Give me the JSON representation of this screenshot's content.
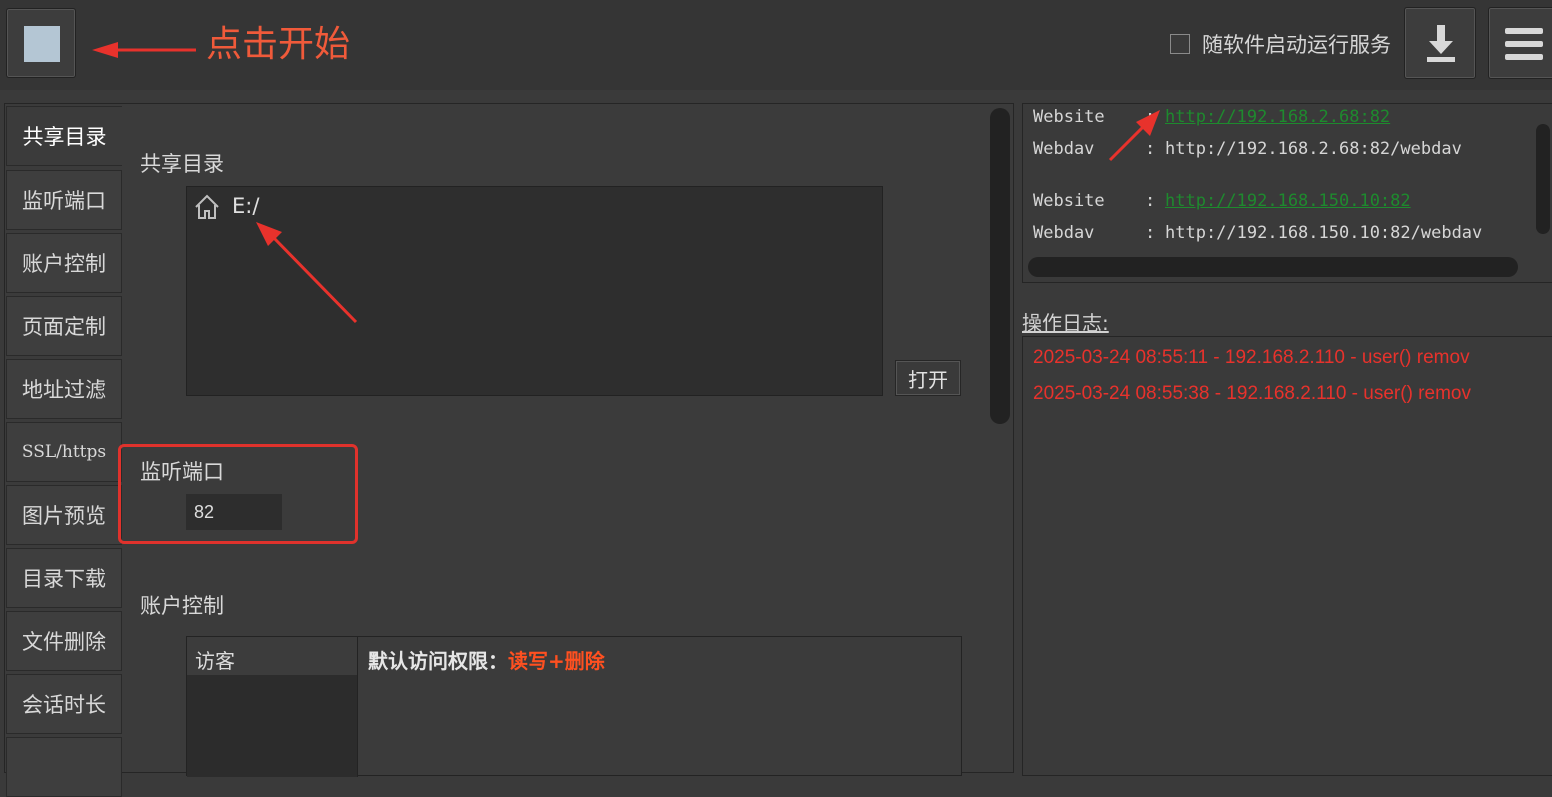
{
  "toolbar": {
    "start_icon": "stop-square-icon",
    "autostart_label": "随软件启动运行服务",
    "download_icon": "download-icon",
    "menu_icon": "hamburger-menu-icon"
  },
  "annotations": {
    "start_hint": "点击开始",
    "color": "#f05a3a"
  },
  "sidebar": {
    "items": [
      {
        "label": "共享目录"
      },
      {
        "label": "监听端口"
      },
      {
        "label": "账户控制"
      },
      {
        "label": "页面定制"
      },
      {
        "label": "地址过滤"
      },
      {
        "label": "SSL/https"
      },
      {
        "label": "图片预览"
      },
      {
        "label": "目录下载"
      },
      {
        "label": "文件删除"
      },
      {
        "label": "会话时长"
      }
    ]
  },
  "share": {
    "title": "共享目录",
    "path": "E:/",
    "open_label": "打开"
  },
  "port": {
    "title": "监听端口",
    "value": "82"
  },
  "account": {
    "title": "账户控制",
    "visitor": "访客",
    "perm_label": "默认访问权限：",
    "perm_value": "读写+删除"
  },
  "urls": [
    {
      "key": "Website",
      "sep": ":",
      "value": "http://192.168.2.68:82"
    },
    {
      "key": "Webdav",
      "sep": ":",
      "value": "http://192.168.2.68:82/webdav"
    },
    {
      "key": "Website",
      "sep": ":",
      "value": "http://192.168.150.10:82"
    },
    {
      "key": "Webdav",
      "sep": ":",
      "value": "http://192.168.150.10:82/webdav"
    }
  ],
  "log": {
    "title": "操作日志:",
    "lines": [
      "2025-03-24 08:55:11 - 192.168.2.110 - user() remov",
      "2025-03-24 08:55:38 - 192.168.2.110 - user() remov"
    ]
  },
  "colors": {
    "link": "#1e8a2e",
    "log_error": "#e8322c",
    "highlight": "#e0322c",
    "perm_value": "#ff5020"
  }
}
